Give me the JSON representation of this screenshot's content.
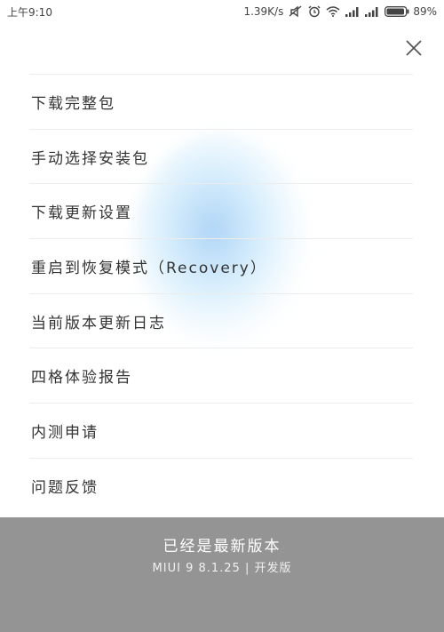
{
  "status_bar": {
    "time": "上午9:10",
    "network_speed": "1.39K/s",
    "battery_percent": "89%",
    "icons": [
      "mute-icon",
      "alarm-icon",
      "wifi-icon",
      "signal-icon",
      "signal-icon",
      "battery-icon"
    ]
  },
  "menu": {
    "items": [
      {
        "label": "下载完整包"
      },
      {
        "label": "手动选择安装包"
      },
      {
        "label": "下载更新设置"
      },
      {
        "label": "重启到恢复模式（Recovery）"
      },
      {
        "label": "当前版本更新日志"
      },
      {
        "label": "四格体验报告"
      },
      {
        "label": "内测申请"
      },
      {
        "label": "问题反馈"
      }
    ]
  },
  "footer": {
    "title": "已经是最新版本",
    "version": "MIUI 9 8.1.25 | 开发版"
  }
}
